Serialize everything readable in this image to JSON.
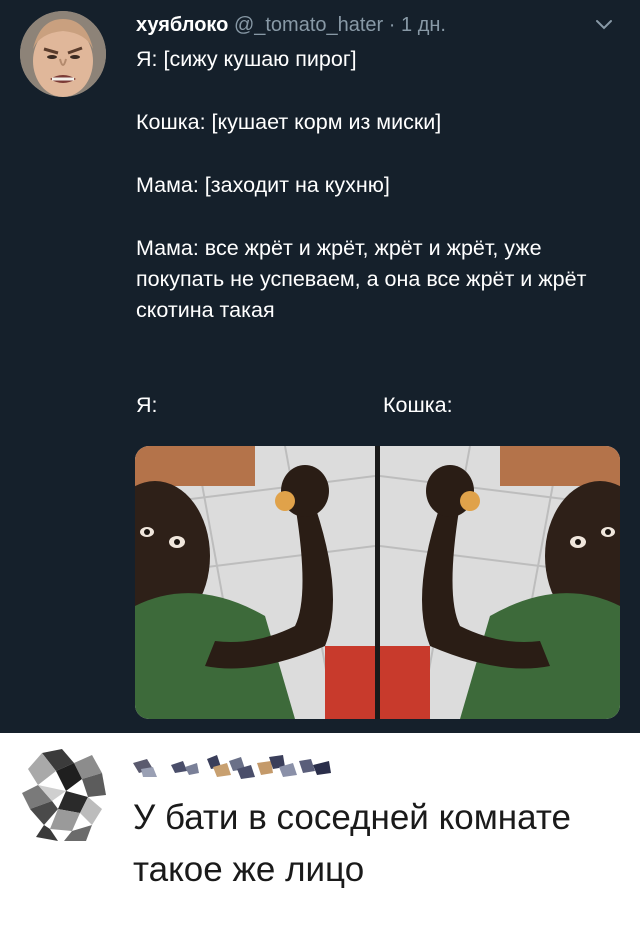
{
  "tweet": {
    "author_name": "хуяблоко",
    "author_handle": "@_tomato_hater",
    "separator": "·",
    "age": "1 дн.",
    "paragraphs": [
      "Я: [сижу кушаю пирог]",
      "Кошка: [кушает корм из миски]",
      "Мама: [заходит на кухню]",
      "Мама: все жрёт и жрёт, жрёт и жрёт, уже покупать не успеваем, а она все жрёт и жрёт скотина такая"
    ],
    "media_labels": {
      "left": "Я:",
      "right": "Кошка:"
    },
    "icons": {
      "avatar": "avatar-photo",
      "menu": "chevron-down-icon"
    },
    "colors": {
      "background": "#15202b",
      "text": "#ffffff",
      "secondary": "#8899a6"
    }
  },
  "comment": {
    "text": "У бати в соседней комнате такое же лицо",
    "icons": {
      "avatar": "pixelated-avatar",
      "author": "pixelated-name"
    }
  }
}
